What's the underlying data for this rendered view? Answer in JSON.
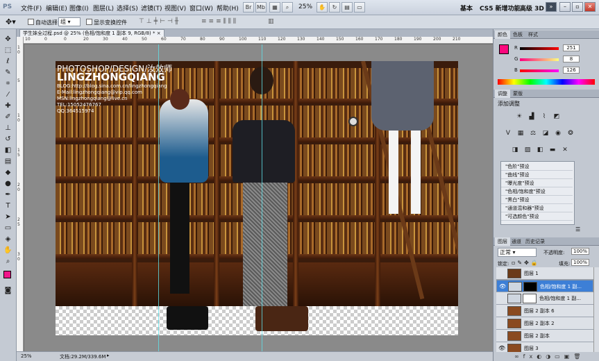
{
  "menubar": {
    "logo": "PS",
    "items": [
      "文件(F)",
      "编辑(E)",
      "图像(I)",
      "图层(L)",
      "选择(S)",
      "滤镜(T)",
      "视图(V)",
      "窗口(W)",
      "帮助(H)"
    ],
    "zoom": "25%",
    "workspaces": [
      "基本",
      "CS5 新增功能",
      "高级 3D"
    ],
    "more": "»"
  },
  "optbar": {
    "auto_select_label": "自动选择:",
    "auto_select_value": "组",
    "show_transform_label": "显示变换控件"
  },
  "document": {
    "tab_title": "学生妹全过程.psd @ 25% (色相/饱和度 1 副本 9, RGB/8) *",
    "overlay": {
      "line1": "PHOTOSHOP/DESIGN/汝效师",
      "line2": "LINGZHONGQIANG",
      "blog": "BLOG:http://blog.sina.com.cn/lingzhongqiang",
      "email": "E-Mail:lingzhongqiang@vip.qq.com",
      "msn": "MSN:lingzhongqiang@live.cn",
      "tel": "TEL:15052476767",
      "qq": "QQ:364515974"
    }
  },
  "rulers": {
    "h": [
      "10",
      "0",
      "0",
      "20",
      "30",
      "40",
      "50",
      "60",
      "70",
      "80",
      "90",
      "100",
      "110",
      "120",
      "130",
      "140",
      "150",
      "160",
      "170",
      "180",
      "190",
      "200",
      "210"
    ],
    "v": [
      "1",
      "0",
      "5",
      "1",
      "0",
      "1",
      "5",
      "2",
      "0",
      "2",
      "5",
      "3",
      "0"
    ]
  },
  "status": {
    "zoom": "25%",
    "doc": "文档:29.2M/339.6M"
  },
  "color_panel": {
    "tabs": [
      "颜色",
      "色板",
      "样式"
    ],
    "r_label": "R",
    "r_value": "251",
    "g_label": "G",
    "g_value": "8",
    "b_label": "B",
    "b_value": "126",
    "fg_color": "#fb087e"
  },
  "adjust_panel": {
    "tabs": [
      "调整",
      "蒙版"
    ],
    "title": "添加调整",
    "presets": [
      "\"色阶\"预设",
      "\"曲线\"预设",
      "\"曝光度\"预设",
      "\"色相/饱和度\"预设",
      "\"黑白\"预设",
      "\"通道混和器\"预设",
      "\"可选颜色\"预设"
    ]
  },
  "layers_panel": {
    "tabs": [
      "图层",
      "通道",
      "历史记录"
    ],
    "blend_mode": "正常",
    "opacity_label": "不透明度:",
    "opacity_value": "100%",
    "lock_label": "锁定:",
    "fill_label": "填充:",
    "fill_value": "100%",
    "layers": [
      {
        "name": "图层 1",
        "visible": false,
        "selected": false
      },
      {
        "name": "色相/饱和度 1 副...",
        "visible": true,
        "selected": true
      },
      {
        "name": "色相/饱和度 1 副...",
        "visible": false,
        "selected": false
      },
      {
        "name": "图层 2 副本 6",
        "visible": false,
        "selected": false
      },
      {
        "name": "图层 2 副本 2",
        "visible": false,
        "selected": false
      },
      {
        "name": "图层 2 副本",
        "visible": false,
        "selected": false
      },
      {
        "name": "图层 3",
        "visible": true,
        "selected": false
      }
    ]
  }
}
